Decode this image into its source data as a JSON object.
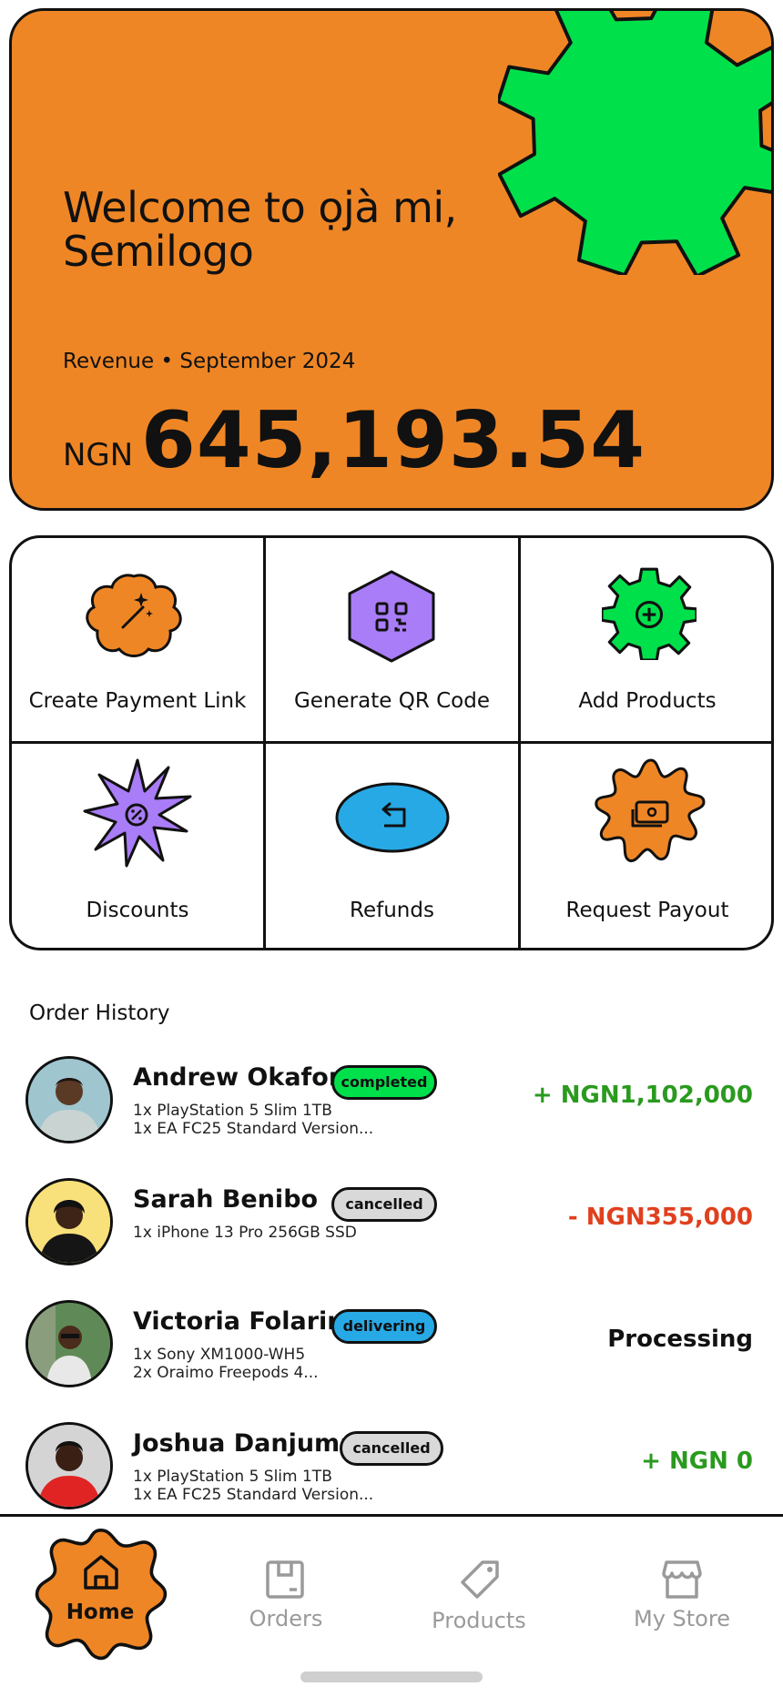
{
  "hero": {
    "welcome": "Welcome to ọjà mi, Semilogo",
    "revenue_label": "Revenue • September 2024",
    "currency": "NGN",
    "amount": "645,193.54"
  },
  "actions": [
    {
      "label": "Create Payment Link",
      "icon": "magic-wand-icon"
    },
    {
      "label": "Generate QR Code",
      "icon": "qr-code-icon"
    },
    {
      "label": "Add Products",
      "icon": "plus-circle-icon"
    },
    {
      "label": "Discounts",
      "icon": "percent-icon"
    },
    {
      "label": "Refunds",
      "icon": "return-arrow-icon"
    },
    {
      "label": "Request Payout",
      "icon": "cash-icon"
    }
  ],
  "orders": {
    "title": "Order History",
    "rows": [
      {
        "name": "Andrew Okafor",
        "status": "completed",
        "items": [
          "1x PlayStation 5 Slim 1TB",
          "1x EA FC25 Standard Version..."
        ],
        "amount": "+ NGN1,102,000"
      },
      {
        "name": "Sarah Benibo",
        "status": "cancelled",
        "items": [
          "1x iPhone 13 Pro 256GB SSD"
        ],
        "amount": "- NGN355,000"
      },
      {
        "name": "Victoria Folarin",
        "status": "delivering",
        "items": [
          "1x Sony XM1000-WH5",
          "2x Oraimo Freepods 4..."
        ],
        "amount": "Processing"
      },
      {
        "name": "Joshua Danjuma",
        "status": "cancelled",
        "items": [
          "1x PlayStation 5 Slim 1TB",
          "1x EA FC25 Standard Version..."
        ],
        "amount": "+ NGN 0"
      }
    ]
  },
  "nav": [
    {
      "label": "Home",
      "icon": "home-icon",
      "active": true
    },
    {
      "label": "Orders",
      "icon": "box-icon"
    },
    {
      "label": "Products",
      "icon": "tag-icon"
    },
    {
      "label": "My Store",
      "icon": "store-icon"
    }
  ],
  "colors": {
    "orange": "#ef8625",
    "green": "#00e04b",
    "purple": "#a97cf8",
    "blue": "#27a9e6",
    "gray_badge": "#d9d9d9",
    "positive": "#2a9a1f",
    "negative": "#e0401e"
  }
}
